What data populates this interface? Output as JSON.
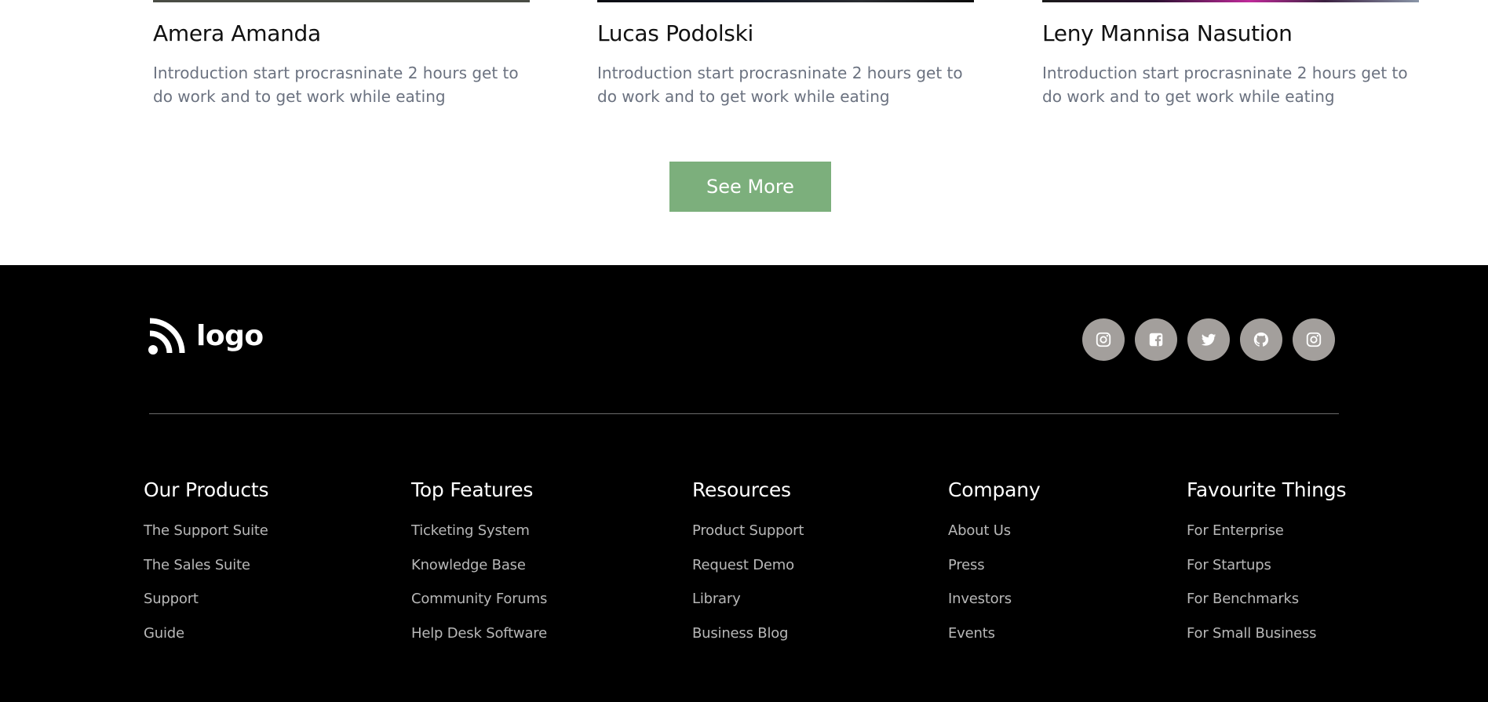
{
  "cards": [
    {
      "name": "Amera Amanda",
      "description": "Introduction start procrasninate 2 hours get to do work and to get work while eating"
    },
    {
      "name": "Lucas Podolski",
      "description": "Introduction start procrasninate 2 hours get to do work and to get work while eating"
    },
    {
      "name": "Leny Mannisa Nasution",
      "description": "Introduction start procrasninate 2 hours get to do work and to get work while eating"
    }
  ],
  "see_more_label": "See More",
  "footer": {
    "logo_text": "logo",
    "socials": [
      {
        "icon": "instagram-icon"
      },
      {
        "icon": "facebook-icon"
      },
      {
        "icon": "twitter-icon"
      },
      {
        "icon": "github-icon"
      },
      {
        "icon": "instagram-icon"
      }
    ],
    "columns": [
      {
        "title": "Our Products",
        "links": [
          "The Support Suite",
          "The Sales Suite",
          "Support",
          "Guide"
        ]
      },
      {
        "title": "Top Features",
        "links": [
          "Ticketing System",
          "Knowledge Base",
          "Community Forums",
          "Help Desk Software"
        ]
      },
      {
        "title": "Resources",
        "links": [
          "Product Support",
          "Request Demo",
          "Library",
          "Business Blog"
        ]
      },
      {
        "title": "Company",
        "links": [
          "About Us",
          "Press",
          "Investors",
          "Events"
        ]
      },
      {
        "title": "Favourite Things",
        "links": [
          "For Enterprise",
          "For Startups",
          "For Benchmarks",
          "For Small Business"
        ]
      }
    ]
  },
  "colors": {
    "accent_green": "#7caf7c",
    "footer_bg": "#000000",
    "social_bg": "#a39f9c"
  }
}
